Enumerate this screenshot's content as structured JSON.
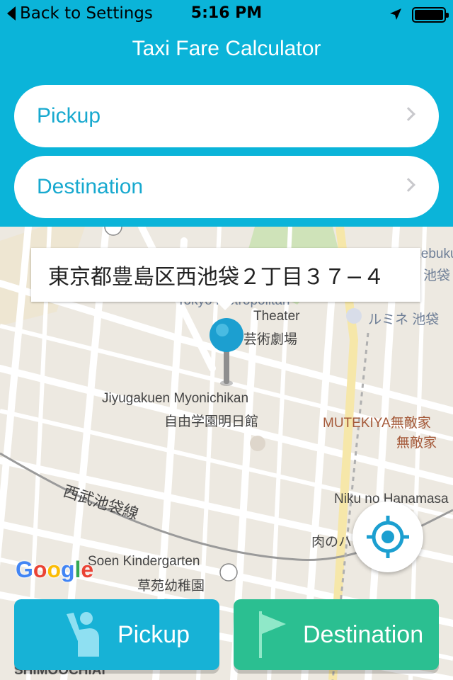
{
  "status_bar": {
    "back_label": "Back to Settings",
    "time": "5:16 PM"
  },
  "nav": {
    "title": "Taxi Fare Calculator"
  },
  "fields": {
    "pickup_label": "Pickup",
    "destination_label": "Destination"
  },
  "map": {
    "address": "東京都豊島区西池袋２丁目３７−４",
    "labels": {
      "theater": "Theater",
      "metropolitan": "Tokyo Metropolitan",
      "geijutsu": "芸術劇場",
      "lumine": "ルミネ 池袋",
      "jiyugakuen_en": "Jiyugakuen Myonichikan",
      "jiyugakuen_jp": "自由学園明日館",
      "mutekiya": "MUTEKIYA無敵家",
      "mutekiya_jp": "無敵家",
      "seibu_line": "西武池袋線",
      "niku": "Niku no Hanamasa",
      "niku_jp": "肉のハナマサ",
      "soen_en": "Soen Kindergarten",
      "soen_jp": "草苑幼稚園",
      "ikebukuro": "Ikebukuro",
      "ikebukuro_jp": "池袋",
      "shimoochiai": "SHIMOOCHIAI"
    },
    "google": "Google"
  },
  "buttons": {
    "pickup": "Pickup",
    "destination": "Destination"
  },
  "colors": {
    "header_bg": "#0bb4d9",
    "field_text": "#17a9cf",
    "pickup_button": "#17b2d6",
    "destination_button": "#2bbf91",
    "pin": "#1c9fd0"
  }
}
